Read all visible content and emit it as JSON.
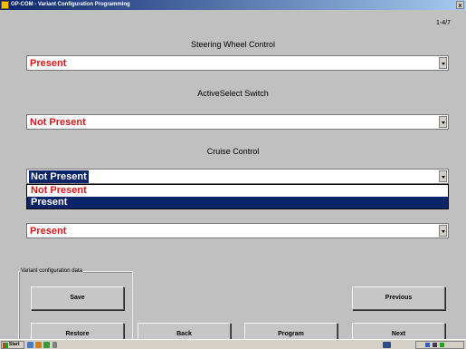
{
  "window": {
    "title": "OP-COM - Variant Configuration Programming",
    "close_label": "x"
  },
  "page_indicator": "1-4/7",
  "fields": [
    {
      "label": "Steering Wheel Control",
      "value": "Present"
    },
    {
      "label": "ActiveSelect Switch",
      "value": "Not Present"
    },
    {
      "label": "Cruise Control",
      "value": "Not Present"
    },
    {
      "label": "",
      "value": "Present"
    }
  ],
  "dropdown": {
    "options": [
      "Not Present",
      "Present"
    ],
    "highlighted_index": 1
  },
  "groupbox": {
    "label": "Variant configuration data"
  },
  "buttons": {
    "save": "Save",
    "restore": "Restore",
    "back": "Back",
    "program": "Program",
    "previous": "Previous",
    "next": "Next"
  },
  "taskbar": {
    "start_label": "Start"
  },
  "colors": {
    "value_text": "#d81818",
    "selection_bg": "#0a246a",
    "window_bg": "#c0c0c0"
  }
}
